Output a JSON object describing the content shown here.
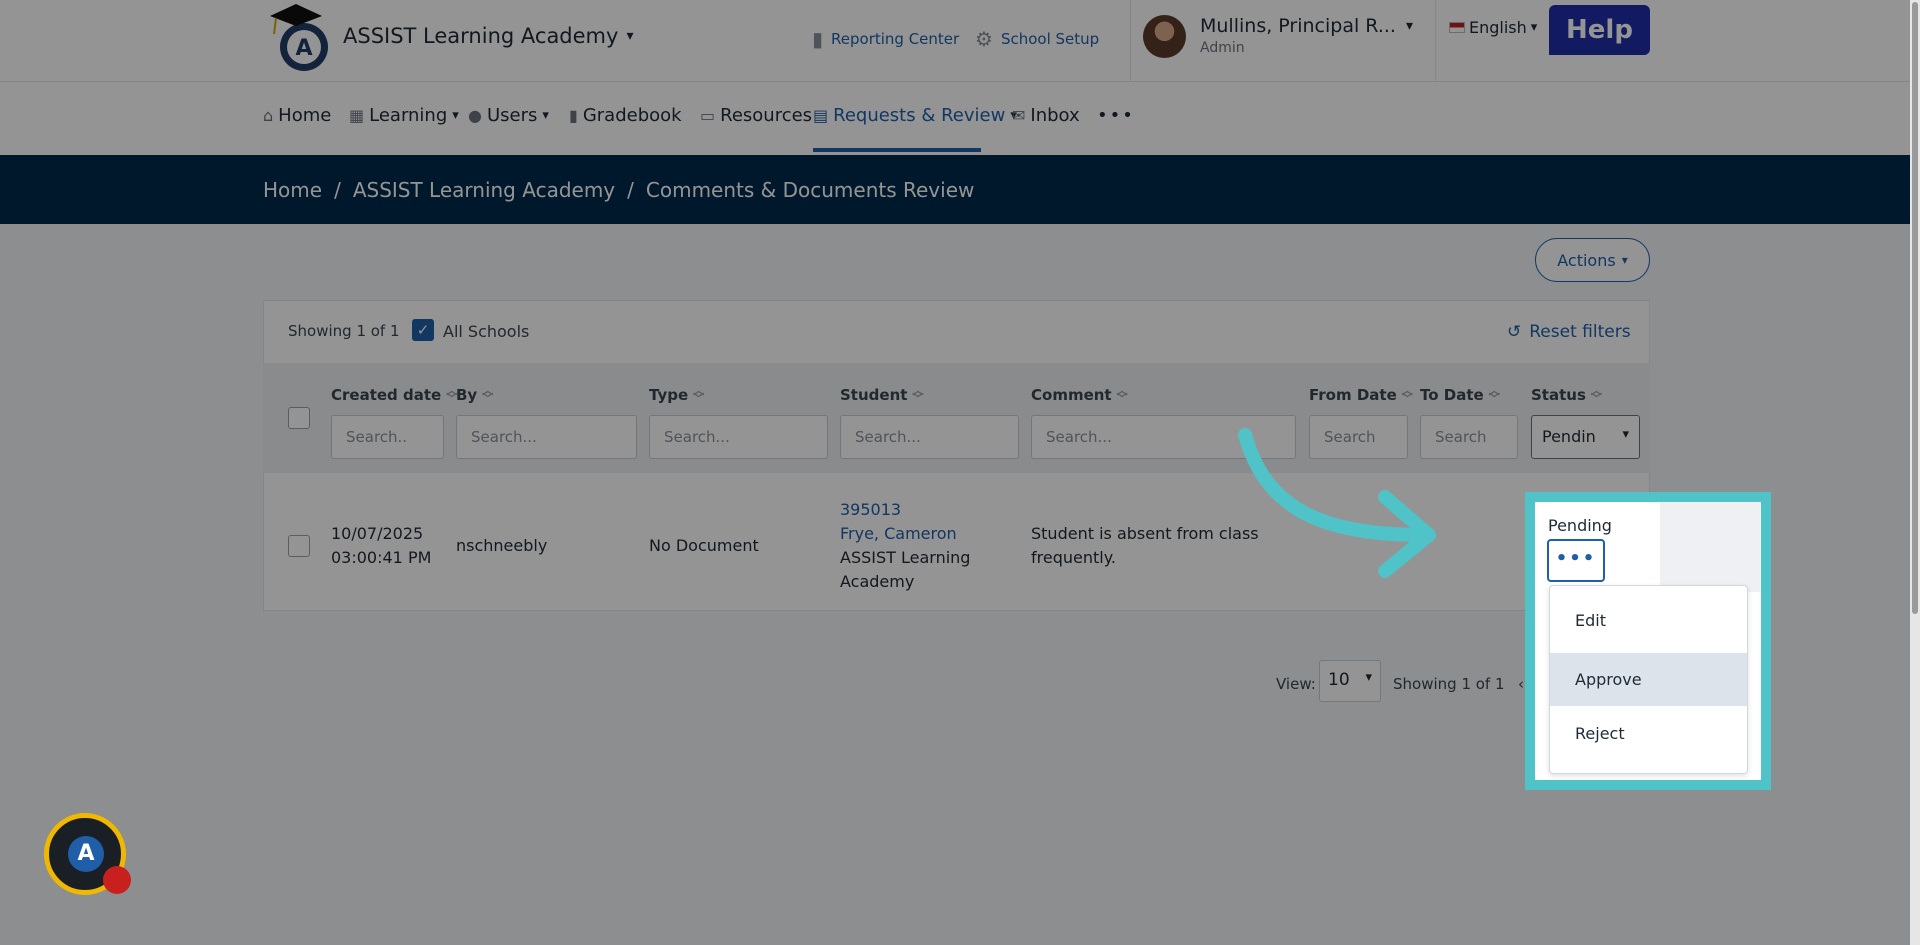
{
  "header": {
    "app_name": "ASSIST Learning Academy",
    "reporting_center": "Reporting Center",
    "school_setup": "School Setup",
    "user_name": "Mullins, Principal R...",
    "user_role": "Admin",
    "language": "English",
    "help": "Help"
  },
  "nav": {
    "items": [
      {
        "label": "Home"
      },
      {
        "label": "Learning"
      },
      {
        "label": "Users"
      },
      {
        "label": "Gradebook"
      },
      {
        "label": "Resources"
      },
      {
        "label": "Requests & Review"
      },
      {
        "label": "Inbox"
      }
    ],
    "more": "•••",
    "active": "Requests & Review"
  },
  "breadcrumb": {
    "items": [
      "Home",
      "ASSIST Learning Academy",
      "Comments & Documents Review"
    ],
    "separator": "/"
  },
  "toolbar": {
    "actions": "Actions",
    "showing": "Showing 1 of 1",
    "all_schools": "All Schools",
    "reset_filters": "Reset filters"
  },
  "table": {
    "columns": [
      {
        "label": "Created date",
        "placeholder": "Search.."
      },
      {
        "label": "By",
        "placeholder": "Search..."
      },
      {
        "label": "Type",
        "placeholder": "Search..."
      },
      {
        "label": "Student",
        "placeholder": "Search..."
      },
      {
        "label": "Comment",
        "placeholder": "Search..."
      },
      {
        "label": "From Date",
        "placeholder": "Search"
      },
      {
        "label": "To Date",
        "placeholder": "Search"
      },
      {
        "label": "Status",
        "filter_value": "Pendin"
      }
    ],
    "rows": [
      {
        "created_date": "10/07/2025",
        "created_time": "03:00:41 PM",
        "by": "nschneebly",
        "type": "No Document",
        "student_id": "395013",
        "student_name": "Frye, Cameron",
        "school_line1": "ASSIST Learning",
        "school_line2": "Academy",
        "comment_line1": "Student is absent from class",
        "comment_line2": "frequently."
      }
    ]
  },
  "pagination": {
    "view_label": "View:",
    "page_size": "10",
    "showing": "Showing 1 of 1"
  },
  "row_menu": {
    "status": "Pending",
    "trigger": "•••",
    "items": [
      "Edit",
      "Approve",
      "Reject"
    ],
    "highlighted": "Approve"
  },
  "colors": {
    "accent": "#1f5fa8",
    "breadcrumb_bg": "#002a4d",
    "highlight": "#4fc3c7",
    "help_bg": "#1f2fa8"
  }
}
